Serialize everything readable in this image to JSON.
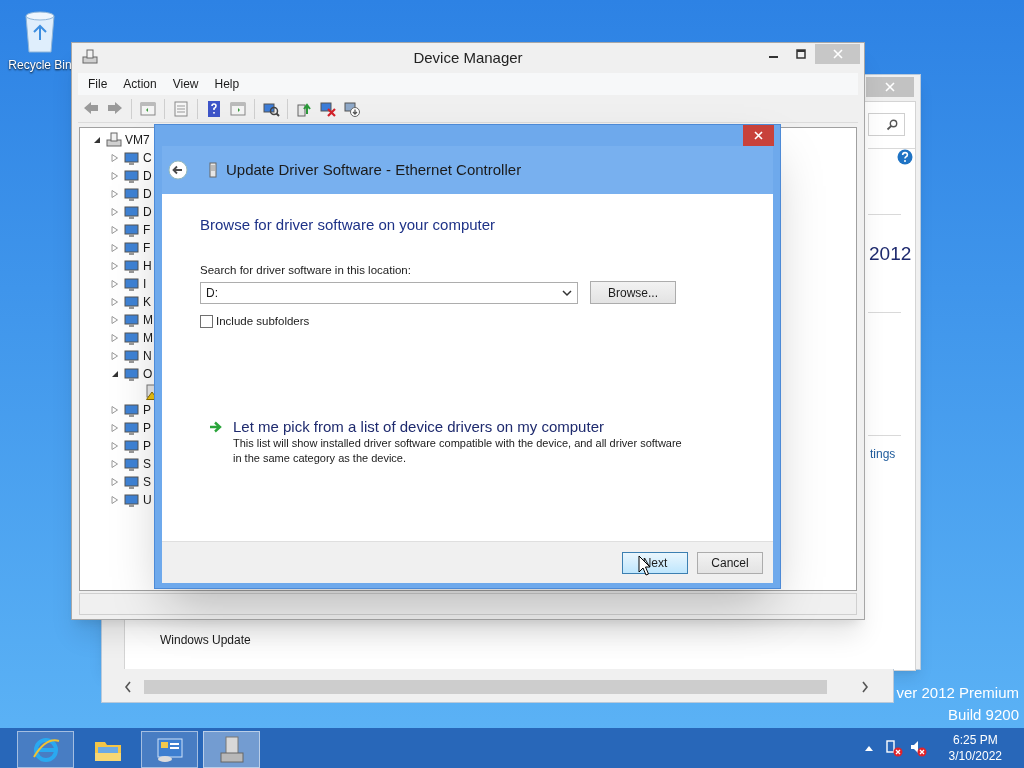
{
  "desktop": {
    "icons": [
      {
        "label": "Recycle Bin"
      }
    ],
    "edition": [
      "ver 2012 Premium",
      "Build 9200"
    ]
  },
  "back_window": {
    "heading_fragment": "2012",
    "link_fragment": "tings",
    "item": "Windows Update"
  },
  "device_manager": {
    "title": "Device Manager",
    "menu": [
      "File",
      "Action",
      "View",
      "Help"
    ],
    "tree": {
      "label": "VM7",
      "expanded": true,
      "children": [
        {
          "label": "C",
          "expanded": false
        },
        {
          "label": "D",
          "expanded": false
        },
        {
          "label": "D",
          "expanded": false
        },
        {
          "label": "D",
          "expanded": false
        },
        {
          "label": "F",
          "expanded": false
        },
        {
          "label": "F",
          "expanded": false
        },
        {
          "label": "H",
          "expanded": false
        },
        {
          "label": "I",
          "expanded": false
        },
        {
          "label": "K",
          "expanded": false
        },
        {
          "label": "M",
          "expanded": false
        },
        {
          "label": "M",
          "expanded": false
        },
        {
          "label": "N",
          "expanded": false
        },
        {
          "label": "O",
          "expanded": true,
          "children": [
            {
              "warning": true
            }
          ]
        },
        {
          "label": "P",
          "expanded": false
        },
        {
          "label": "P",
          "expanded": false
        },
        {
          "label": "P",
          "expanded": false
        },
        {
          "label": "S",
          "expanded": false
        },
        {
          "label": "S",
          "expanded": false
        },
        {
          "label": "U",
          "expanded": false
        }
      ]
    }
  },
  "dialog": {
    "title": "Update Driver Software - Ethernet Controller",
    "heading": "Browse for driver software on your computer",
    "location_label": "Search for driver software in this location:",
    "location_value": "D:",
    "browse": "Browse...",
    "include_subfolders": {
      "label": "Include subfolders",
      "checked": false
    },
    "pick": {
      "title": "Let me pick from a list of device drivers on my computer",
      "description": "This list will show installed driver software compatible with the device, and all driver software in the same category as the device."
    },
    "buttons": [
      {
        "label": "Next",
        "default": true
      },
      {
        "label": "Cancel",
        "default": false
      }
    ]
  },
  "taskbar": {
    "items": [
      {
        "kind": "browser",
        "running": true,
        "active": false
      },
      {
        "kind": "folder",
        "running": false,
        "active": false
      },
      {
        "kind": "server",
        "running": true,
        "active": false
      },
      {
        "kind": "device-manager",
        "running": true,
        "active": true
      }
    ],
    "time": "6:25 PM",
    "date": "3/10/2022"
  }
}
